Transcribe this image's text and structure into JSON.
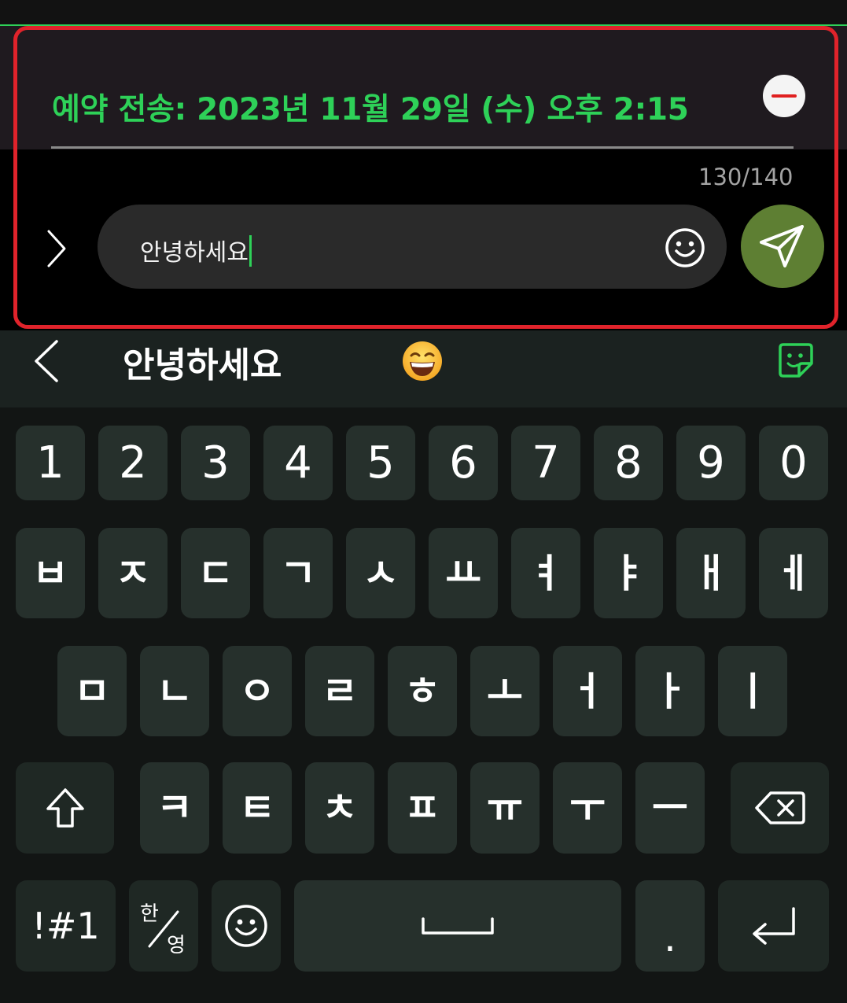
{
  "schedule": {
    "text": "예약 전송: 2023년 11월 29일 (수) 오후 2:15",
    "cancel_icon": "remove-circle-icon"
  },
  "composer": {
    "char_count": "130/140",
    "message": "안녕하세요",
    "expand_icon": "chevron-right-icon",
    "emoji_icon": "smiley-icon",
    "send_icon": "paper-plane-icon"
  },
  "suggestions": {
    "word": "안녕하세요",
    "emoji": "😄",
    "back_icon": "chevron-left-icon",
    "sticker_icon": "sticker-icon"
  },
  "keyboard": {
    "numbers": [
      "1",
      "2",
      "3",
      "4",
      "5",
      "6",
      "7",
      "8",
      "9",
      "0"
    ],
    "row1": [
      "ㅂ",
      "ㅈ",
      "ㄷ",
      "ㄱ",
      "ㅅ",
      "ㅛ",
      "ㅕ",
      "ㅑ",
      "ㅐ",
      "ㅔ"
    ],
    "row2": [
      "ㅁ",
      "ㄴ",
      "ㅇ",
      "ㄹ",
      "ㅎ",
      "ㅗ",
      "ㅓ",
      "ㅏ",
      "ㅣ"
    ],
    "row3": [
      "ㅋ",
      "ㅌ",
      "ㅊ",
      "ㅍ",
      "ㅠ",
      "ㅜ",
      "ㅡ"
    ],
    "symbols_label": "!#1",
    "lang_top": "한",
    "lang_bottom": "영",
    "period": "."
  },
  "colors": {
    "accent": "#2ed158",
    "highlight": "#e0232b",
    "send": "#5e7f33",
    "key": "#26302c"
  }
}
